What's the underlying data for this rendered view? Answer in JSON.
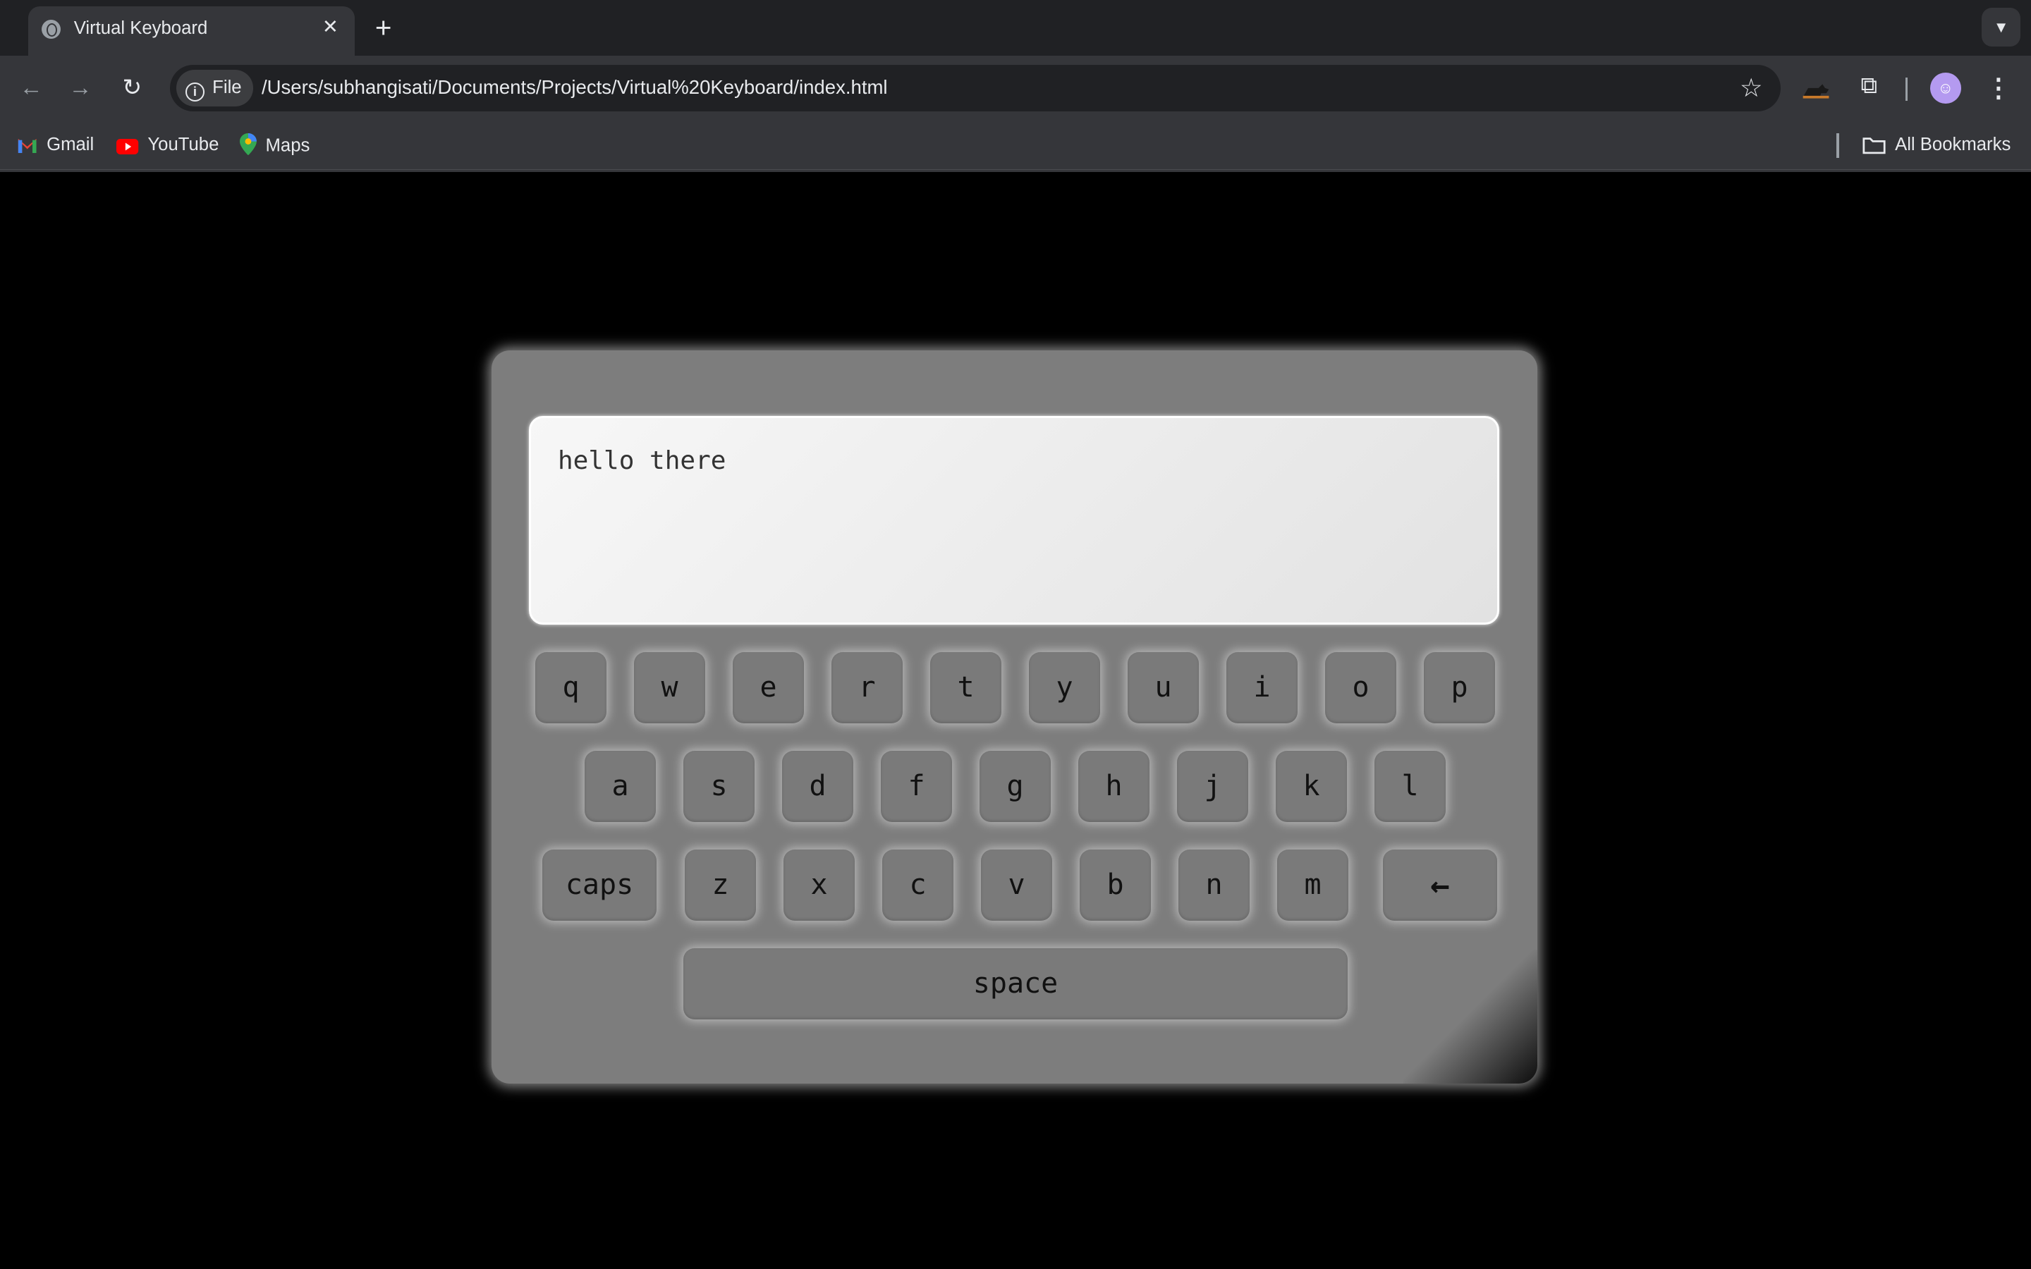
{
  "browser": {
    "tab_title": "Virtual Keyboard",
    "site_chip": "File",
    "url": "/Users/subhangisati/Documents/Projects/Virtual%20Keyboard/index.html",
    "bookmarks": [
      "Gmail",
      "YouTube",
      "Maps"
    ],
    "all_bookmarks": "All Bookmarks",
    "icons": [
      "globe-icon",
      "close-icon",
      "plus-icon",
      "chevron-down-icon",
      "back-arrow-icon",
      "forward-arrow-icon",
      "reload-icon",
      "info-icon",
      "star-icon",
      "cat-extension-icon",
      "puzzle-icon",
      "avatar-icon",
      "more-vert-icon",
      "gmail-icon",
      "youtube-icon",
      "maps-pin-icon",
      "folder-icon"
    ]
  },
  "keyboard": {
    "textarea_value": "hello there",
    "rows": [
      [
        "q",
        "w",
        "e",
        "r",
        "t",
        "y",
        "u",
        "i",
        "o",
        "p"
      ],
      [
        "a",
        "s",
        "d",
        "f",
        "g",
        "h",
        "j",
        "k",
        "l"
      ],
      [
        "caps",
        "z",
        "x",
        "c",
        "v",
        "b",
        "n",
        "m",
        "←"
      ]
    ],
    "space_label": "space",
    "colors": {
      "panel": "#7d7d7d",
      "key": "#7a7a7a",
      "background": "#000000"
    }
  }
}
